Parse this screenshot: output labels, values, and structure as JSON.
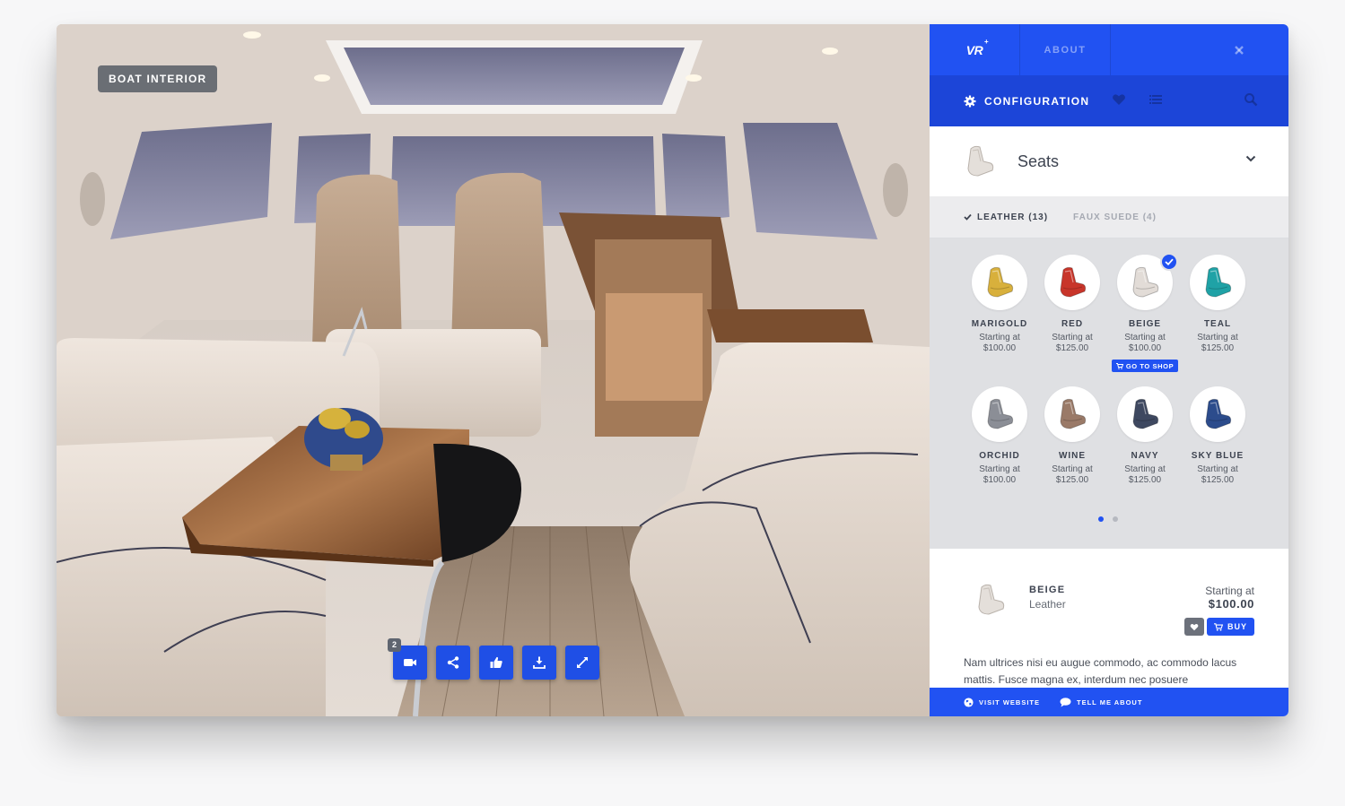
{
  "viewer": {
    "scene_label": "BOAT INTERIOR",
    "toolbar": {
      "video_badge": "2",
      "buttons": [
        {
          "icon": "video-camera-icon"
        },
        {
          "icon": "share-icon"
        },
        {
          "icon": "thumbs-up-icon"
        },
        {
          "icon": "download-icon"
        },
        {
          "icon": "fullscreen-icon"
        }
      ]
    }
  },
  "panel": {
    "topbar": {
      "logo": "VR",
      "logo_sup": "+",
      "about": "ABOUT",
      "close_icon": "close-icon"
    },
    "config_bar": {
      "label": "CONFIGURATION",
      "icons": [
        "gear-icon",
        "heart-icon",
        "list-icon",
        "search-icon"
      ]
    },
    "category": {
      "title": "Seats",
      "icon": "chevron-down-icon"
    },
    "filters": [
      {
        "label": "LEATHER (13)",
        "active": true
      },
      {
        "label": "FAUX SUEDE (4)",
        "active": false
      }
    ],
    "swatches": [
      {
        "name": "MARIGOLD",
        "price_label": "Starting at",
        "price": "$100.00",
        "color": "#d8b03c"
      },
      {
        "name": "RED",
        "price_label": "Starting at",
        "price": "$125.00",
        "color": "#c8352a"
      },
      {
        "name": "BEIGE",
        "price_label": "Starting at",
        "price": "$100.00",
        "color": "#e2dcd7",
        "selected": true,
        "shop_label": "GO TO SHOP"
      },
      {
        "name": "TEAL",
        "price_label": "Starting at",
        "price": "$125.00",
        "color": "#1fa2a6"
      },
      {
        "name": "ORCHID",
        "price_label": "Starting at",
        "price": "$100.00",
        "color": "#8b8e96"
      },
      {
        "name": "WINE",
        "price_label": "Starting at",
        "price": "$125.00",
        "color": "#9a7a68"
      },
      {
        "name": "NAVY",
        "price_label": "Starting at",
        "price": "$125.00",
        "color": "#3e4860"
      },
      {
        "name": "SKY BLUE",
        "price_label": "Starting at",
        "price": "$125.00",
        "color": "#2c4c8c"
      }
    ],
    "pagination": {
      "pages": 2,
      "current": 1
    },
    "detail": {
      "name": "BEIGE",
      "material": "Leather",
      "price_label": "Starting at",
      "price": "$100.00",
      "buy_label": "BUY",
      "description": "Nam ultrices nisi eu augue commodo, ac commodo lacus mattis. Fusce magna ex, interdum nec posuere"
    },
    "footer": {
      "visit": "VISIT WEBSITE",
      "tell": "TELL ME ABOUT"
    }
  },
  "colors": {
    "accent": "#2152f2",
    "accent_dark": "#1c45d8"
  }
}
